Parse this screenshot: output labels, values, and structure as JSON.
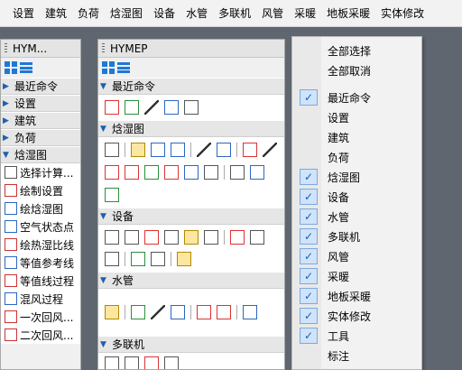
{
  "menubar": {
    "items": [
      "设置",
      "建筑",
      "负荷",
      "焓湿图",
      "设备",
      "水管",
      "多联机",
      "风管",
      "采暖",
      "地板采暖",
      "实体修改"
    ]
  },
  "left_panel": {
    "title": "HYM...",
    "sections": [
      "最近命令",
      "设置",
      "建筑",
      "负荷",
      "焓湿图"
    ],
    "items": [
      {
        "label": "选择计算...",
        "icon": "calc-select-icon"
      },
      {
        "label": "绘制设置",
        "icon": "draw-settings-icon"
      },
      {
        "label": "绘焓湿图",
        "icon": "psychro-chart-icon"
      },
      {
        "label": "空气状态点",
        "icon": "air-state-point-icon"
      },
      {
        "label": "绘热湿比线",
        "icon": "heat-humidity-ratio-icon"
      },
      {
        "label": "等值参考线",
        "icon": "iso-line-rh-icon"
      },
      {
        "label": "等值线过程",
        "icon": "iso-process-icon"
      },
      {
        "label": "混风过程",
        "icon": "mixing-process-icon"
      },
      {
        "label": "一次回风...",
        "icon": "primary-return-icon"
      },
      {
        "label": "二次回风...",
        "icon": "secondary-return-icon"
      }
    ]
  },
  "mid_panel": {
    "title": "HYMEP",
    "sections": [
      "最近命令",
      "焓湿图",
      "设备",
      "水管",
      "多联机"
    ]
  },
  "context_menu": {
    "top_items": [
      "全部选择",
      "全部取消"
    ],
    "items": [
      {
        "label": "最近命令",
        "checked": true
      },
      {
        "label": "设置",
        "checked": false
      },
      {
        "label": "建筑",
        "checked": false
      },
      {
        "label": "负荷",
        "checked": false
      },
      {
        "label": "焓湿图",
        "checked": true
      },
      {
        "label": "设备",
        "checked": true
      },
      {
        "label": "水管",
        "checked": true
      },
      {
        "label": "多联机",
        "checked": true
      },
      {
        "label": "风管",
        "checked": true
      },
      {
        "label": "采暖",
        "checked": true
      },
      {
        "label": "地板采暖",
        "checked": true
      },
      {
        "label": "实体修改",
        "checked": true
      },
      {
        "label": "工具",
        "checked": true
      },
      {
        "label": "标注",
        "checked": false
      }
    ],
    "check_mark": "✓"
  },
  "colors": {
    "accent": "#1e78d7",
    "menu_bg": "#f2f2f2",
    "background": "#5f6670"
  }
}
